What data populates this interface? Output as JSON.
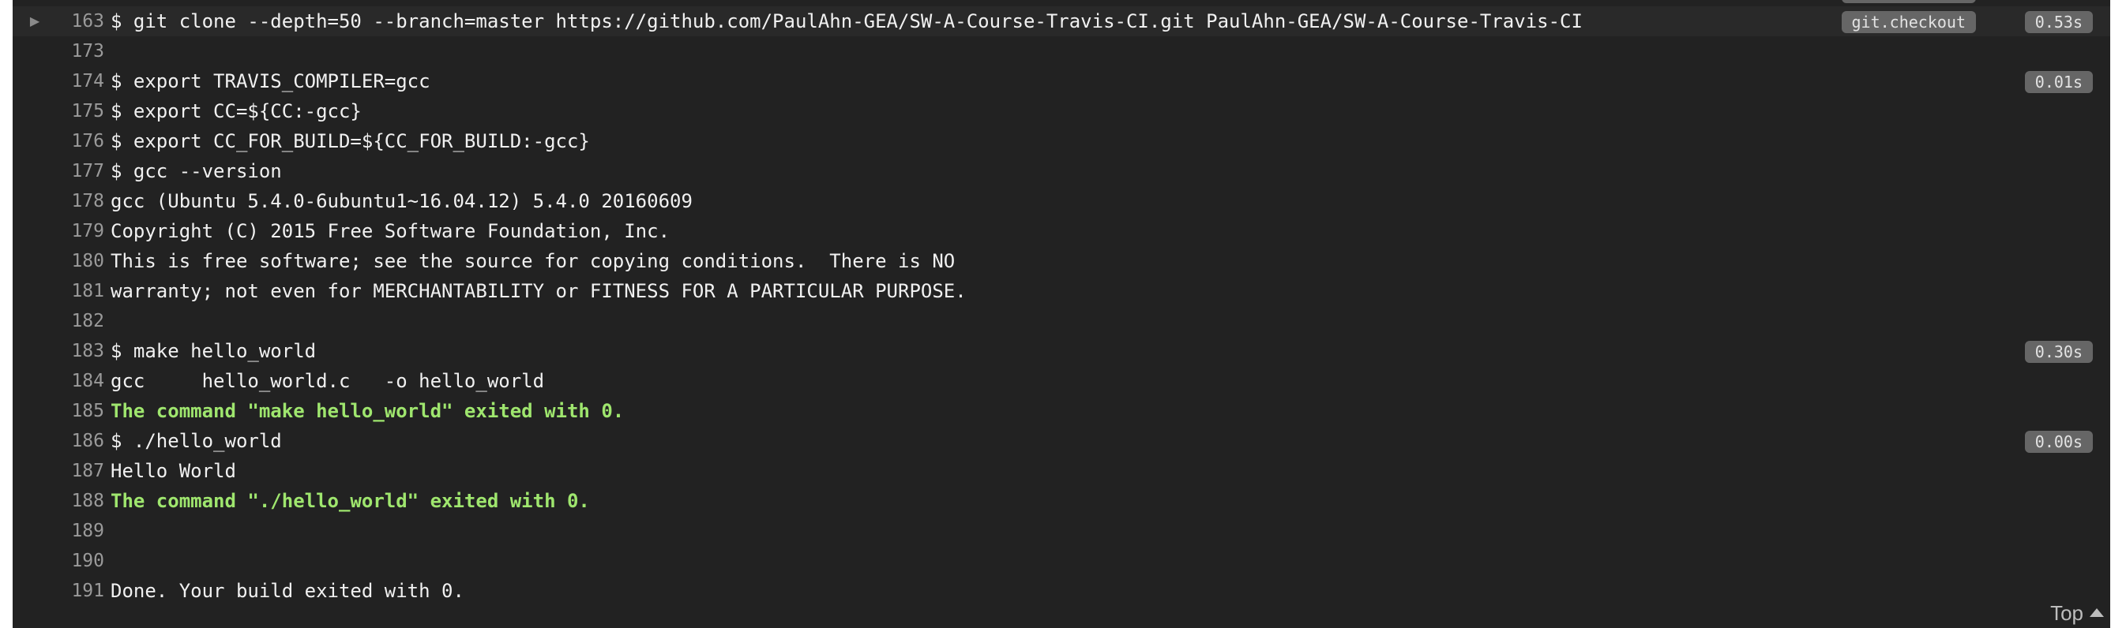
{
  "log": {
    "fold": {
      "line_number": "163",
      "text": "$ git clone --depth=50 --branch=master https://github.com/PaulAhn-GEA/SW-A-Course-Travis-CI.git PaulAhn-GEA/SW-A-Course-Travis-CI",
      "fold_name": "git.checkout",
      "duration": "0.53s"
    },
    "lines": [
      {
        "number": "173",
        "text": ""
      },
      {
        "number": "174",
        "text": "$ export TRAVIS_COMPILER=gcc",
        "duration": "0.01s"
      },
      {
        "number": "175",
        "text": "$ export CC=${CC:-gcc}"
      },
      {
        "number": "176",
        "text": "$ export CC_FOR_BUILD=${CC_FOR_BUILD:-gcc}"
      },
      {
        "number": "177",
        "text": "$ gcc --version"
      },
      {
        "number": "178",
        "text": "gcc (Ubuntu 5.4.0-6ubuntu1~16.04.12) 5.4.0 20160609"
      },
      {
        "number": "179",
        "text": "Copyright (C) 2015 Free Software Foundation, Inc."
      },
      {
        "number": "180",
        "text": "This is free software; see the source for copying conditions.  There is NO"
      },
      {
        "number": "181",
        "text": "warranty; not even for MERCHANTABILITY or FITNESS FOR A PARTICULAR PURPOSE."
      },
      {
        "number": "182",
        "text": ""
      },
      {
        "number": "183",
        "text": "$ make hello_world",
        "duration": "0.30s"
      },
      {
        "number": "184",
        "text": "gcc     hello_world.c   -o hello_world"
      },
      {
        "number": "185",
        "text": "The command \"make hello_world\" exited with 0."
      },
      {
        "number": "186",
        "text": "$ ./hello_world",
        "duration": "0.00s"
      },
      {
        "number": "187",
        "text": "Hello World"
      },
      {
        "number": "188",
        "text": "The command \"./hello_world\" exited with 0."
      },
      {
        "number": "189",
        "text": ""
      },
      {
        "number": "190",
        "text": ""
      },
      {
        "number": "191",
        "text": "Done. Your build exited with 0."
      }
    ]
  },
  "top_link": {
    "label": "Top",
    "icon": "caret-up-icon"
  },
  "colors": {
    "background": "#222222",
    "text": "#f1f1f1",
    "success": "#9fe66e",
    "badge": "#666666",
    "line_number": "#9a9a9a"
  }
}
